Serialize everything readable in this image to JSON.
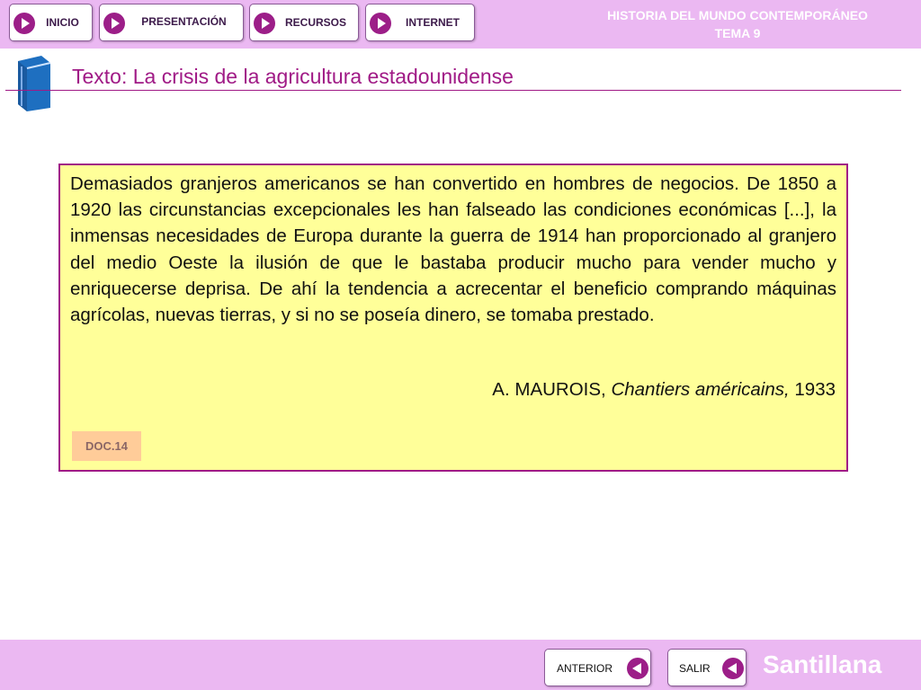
{
  "nav": {
    "inicio": "INICIO",
    "presentacion": "PRESENTACIÓN",
    "recursos": "RECURSOS",
    "internet": "INTERNET"
  },
  "header": {
    "course_line1": "HISTORIA DEL MUNDO CONTEMPORÁNEO",
    "course_line2": "TEMA 9"
  },
  "page": {
    "title": "Texto: La crisis de la agricultura estadounidense"
  },
  "document": {
    "body": "Demasiados granjeros americanos se han convertido en hombres de negocios. De 1850 a 1920 las circunstancias excepcionales les han falseado las condiciones económicas [...], la inmensas necesidades de Europa durante la guerra de 1914 han proporcionado al granjero del medio Oeste la ilusión de que le bastaba producir mucho para vender mucho y enriquecerse deprisa. De ahí la tendencia a acrecentar el beneficio comprando máquinas agrícolas, nuevas tierras, y si no se poseía dinero, se tomaba prestado.",
    "author": "A. MAUROIS,",
    "work": "Chantiers américains,",
    "year": "1933",
    "tag": "DOC.14"
  },
  "footer": {
    "anterior": "ANTERIOR",
    "salir": "SALIR",
    "brand": "Santillana"
  },
  "colors": {
    "bar": "#ebb8f2",
    "accent": "#a01a86",
    "doc_background": "#ffff99",
    "doc_tag": "#ffcc99"
  },
  "icons": {
    "nav_play": "play-circle-icon",
    "back": "back-arrow-circle-icon",
    "book": "book-icon"
  }
}
